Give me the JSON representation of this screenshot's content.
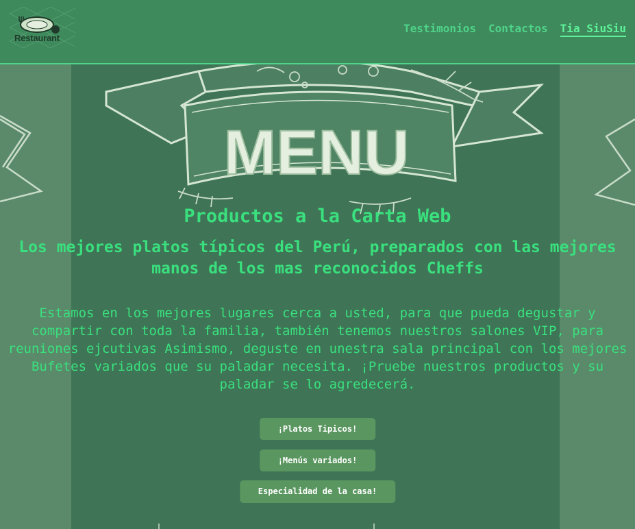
{
  "header": {
    "logo_text": "Restaurant",
    "nav": [
      {
        "label": "Testimonios",
        "active": false
      },
      {
        "label": "Contactos",
        "active": false
      },
      {
        "label": "Tia SiuSiu",
        "active": true
      }
    ]
  },
  "hero": {
    "chalkboard_word": "MENU",
    "title": "Productos a la Carta Web",
    "subtitle": "Los mejores platos típicos del Perú, preparados con las mejores manos de los mas reconocidos Cheffs",
    "description": "Estamos en los mejores lugares cerca a usted, para que pueda degustar y compartir con toda la familia, también tenemos nuestros salones VIP, para reuniones ejcutivas Asimismo, deguste en unestra sala principal con los mejores Bufetes variados que su paladar necesita. ¡Pruebe nuestros productos y su paladar se lo agredecerá.",
    "buttons": [
      {
        "label": "¡Platos Tipicos!"
      },
      {
        "label": "¡Menús variados!"
      },
      {
        "label": "Especialidad de la casa!"
      }
    ]
  },
  "colors": {
    "header_bg": "#3f8a5c",
    "accent_green": "#3ae07e",
    "button_bg": "#5a9660",
    "chalkboard": "#3f7456"
  }
}
